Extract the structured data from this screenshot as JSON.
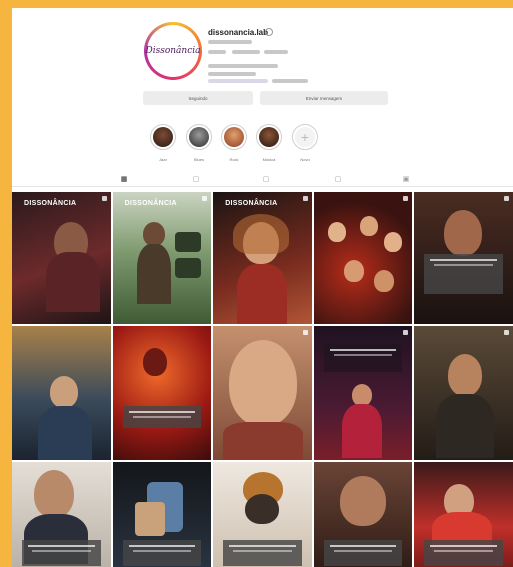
{
  "profile": {
    "username": "dissonancia.lab",
    "logo_text": "Dissonância"
  },
  "buttons": {
    "following": "Seguindo",
    "message": "Enviar mensagem"
  },
  "highlights": [
    {
      "label": "Jazz"
    },
    {
      "label": "Blues"
    },
    {
      "label": "Rock"
    },
    {
      "label": "Música"
    },
    {
      "label": "Novo"
    }
  ],
  "posts": [
    {
      "title": "DISSONÂNCIA",
      "color": "#3a1c1f"
    },
    {
      "title": "DISSONÂNCIA",
      "color": "#6f8c6a"
    },
    {
      "title": "DISSONÂNCIA",
      "color": "#8a3326"
    },
    {
      "title": "",
      "color": "#3b1713"
    },
    {
      "title": "",
      "color": "#2b1d1a"
    },
    {
      "title": "",
      "color": "#6b5a3d"
    },
    {
      "title": "",
      "color": "#a3261b"
    },
    {
      "title": "",
      "color": "#b67a60"
    },
    {
      "title": "",
      "color": "#3a1831"
    },
    {
      "title": "",
      "color": "#2a241f"
    },
    {
      "title": "",
      "color": "#d6d0c7"
    },
    {
      "title": "",
      "color": "#1c1f24"
    },
    {
      "title": "",
      "color": "#e9e3dc"
    },
    {
      "title": "",
      "color": "#5c3a2d"
    },
    {
      "title": "",
      "color": "#b62e2c"
    }
  ]
}
